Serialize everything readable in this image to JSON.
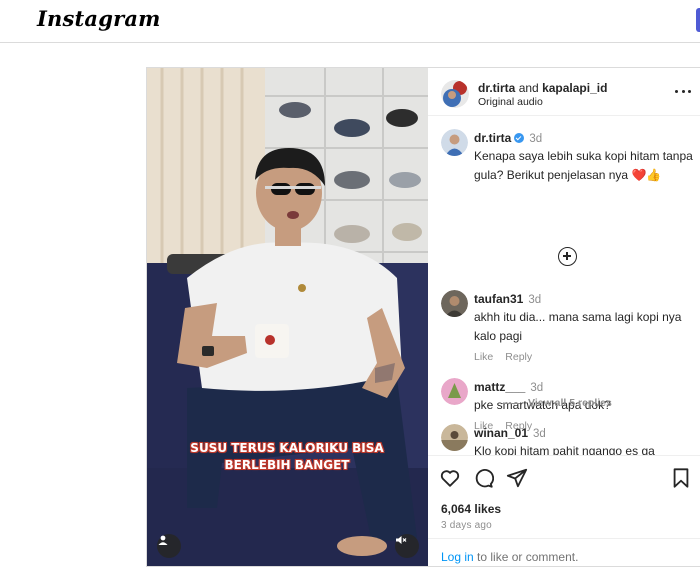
{
  "header": {
    "logo": "Instagram"
  },
  "post": {
    "video_caption_line1": "SUSU TERUS KALORIKU BISA",
    "video_caption_line2": "BERLEBIH BANGET",
    "author": "dr.tirta",
    "joiner": "and",
    "collaborator": "kapalapi_id",
    "audio": "Original audio",
    "caption": {
      "username": "dr.tirta",
      "time": "3d",
      "text": "Kenapa saya lebih suka kopi hitam tanpa gula? Berikut penjelasan nya ❤️👍"
    },
    "comments": [
      {
        "username": "taufan31",
        "time": "3d",
        "text": "akhh itu dia... mana sama lagi kopi nya kalo pagi",
        "like": "Like",
        "reply": "Reply"
      },
      {
        "username": "mattz___",
        "time": "3d",
        "text": "pke smartwatch apa dok?",
        "like": "Like",
        "reply": "Reply"
      },
      {
        "username": "winan_01",
        "time": "3d",
        "text": "Klo kopi hitam pahit ngango es ga"
      }
    ],
    "view_replies": "View all 5 replies",
    "likes": "6,064 likes",
    "posted_ago": "3 days ago",
    "login_link": "Log in",
    "login_suffix": " to like or comment."
  },
  "icons": {
    "more": "more-options-icon",
    "add": "plus-circle-icon",
    "like": "heart-icon",
    "comment": "comment-icon",
    "share": "send-icon",
    "save": "bookmark-icon",
    "user": "user-icon",
    "mute": "speaker-muted-icon"
  },
  "colors": {
    "link": "#0095f6",
    "muted": "#8e8e8e",
    "verified": "#3897f0",
    "caption_outline": "#c0392b"
  }
}
